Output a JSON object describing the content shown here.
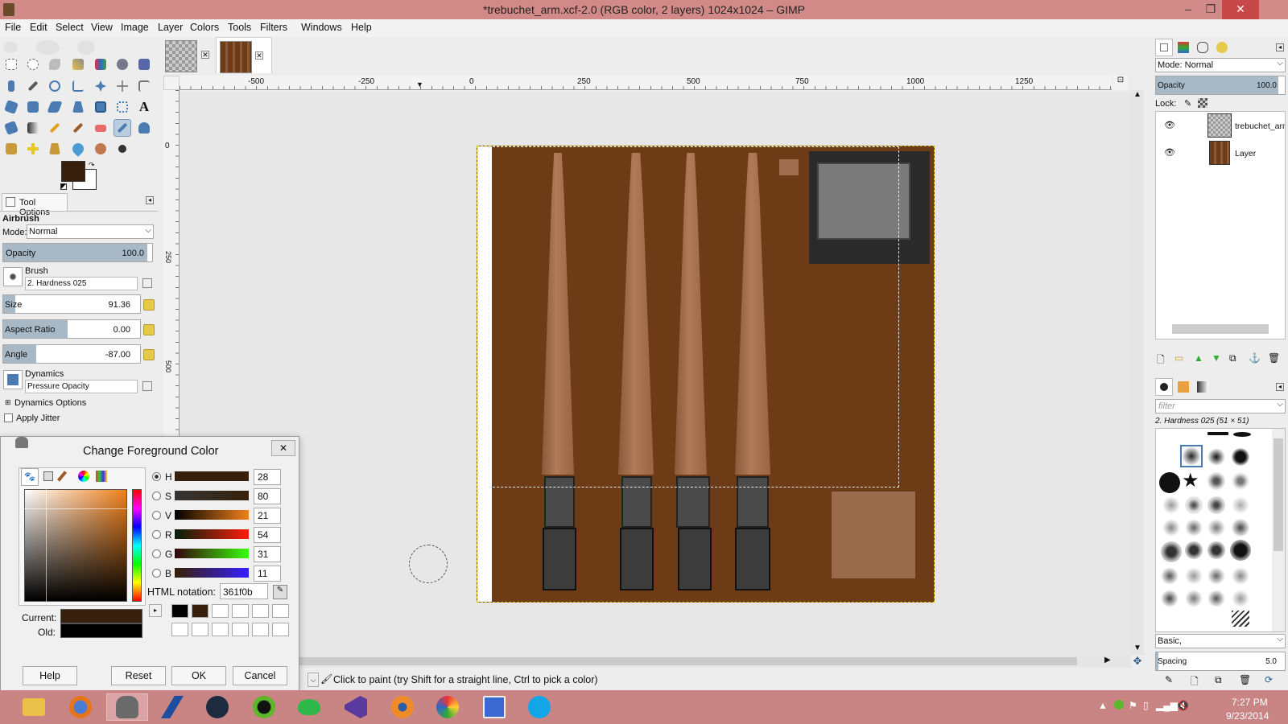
{
  "window": {
    "title": "*trebuchet_arm.xcf-2.0 (RGB color, 2 layers) 1024x1024 – GIMP"
  },
  "menu": [
    "File",
    "Edit",
    "Select",
    "View",
    "Image",
    "Layer",
    "Colors",
    "Tools",
    "Filters",
    "Windows",
    "Help"
  ],
  "rulers": {
    "h_ticks": [
      "-500",
      "-250",
      "0",
      "250",
      "500",
      "750",
      "1000",
      "1250"
    ],
    "v_ticks": [
      "0",
      "250",
      "500"
    ]
  },
  "tool_options": {
    "tab": "Tool Options",
    "tool": "Airbrush",
    "mode_label": "Mode:",
    "mode_value": "Normal",
    "opacity_label": "Opacity",
    "opacity_value": "100.0",
    "brush_label": "Brush",
    "brush_value": "2. Hardness 025",
    "size_label": "Size",
    "size_value": "91.36",
    "aspect_label": "Aspect Ratio",
    "aspect_value": "0.00",
    "angle_label": "Angle",
    "angle_value": "-87.00",
    "dynamics_label": "Dynamics",
    "dynamics_value": "Pressure Opacity",
    "dyn_options": "Dynamics Options",
    "apply_jitter": "Apply Jitter"
  },
  "fg_dialog": {
    "title": "Change Foreground Color",
    "channels": [
      {
        "n": "H",
        "v": "28"
      },
      {
        "n": "S",
        "v": "80"
      },
      {
        "n": "V",
        "v": "21"
      },
      {
        "n": "R",
        "v": "54"
      },
      {
        "n": "G",
        "v": "31"
      },
      {
        "n": "B",
        "v": "11"
      }
    ],
    "html_label": "HTML notation:",
    "html_value": "361f0b",
    "current_label": "Current:",
    "old_label": "Old:",
    "buttons": {
      "help": "Help",
      "reset": "Reset",
      "ok": "OK",
      "cancel": "Cancel"
    },
    "current_color": "#361f0b",
    "old_color": "#000000"
  },
  "status": {
    "hint": "Click to paint (try Shift for a straight line, Ctrl to pick a color)"
  },
  "layers": {
    "mode_label": "Mode: Normal",
    "opacity_label": "Opacity",
    "opacity_value": "100.0",
    "lock_label": "Lock:",
    "items": [
      "trebuchet_arm",
      "Layer"
    ]
  },
  "brushes": {
    "filter_placeholder": "filter",
    "selected": "2. Hardness 025 (51 × 51)",
    "preset": "Basic,",
    "spacing_label": "Spacing",
    "spacing_value": "5.0"
  },
  "clock": {
    "time": "7:27 PM",
    "date": "9/23/2014"
  },
  "colors": {
    "fg": "#361f0b",
    "texture_bg": "#6e3b17",
    "titlebar": "#d28a88",
    "taskbar": "#c98484"
  }
}
